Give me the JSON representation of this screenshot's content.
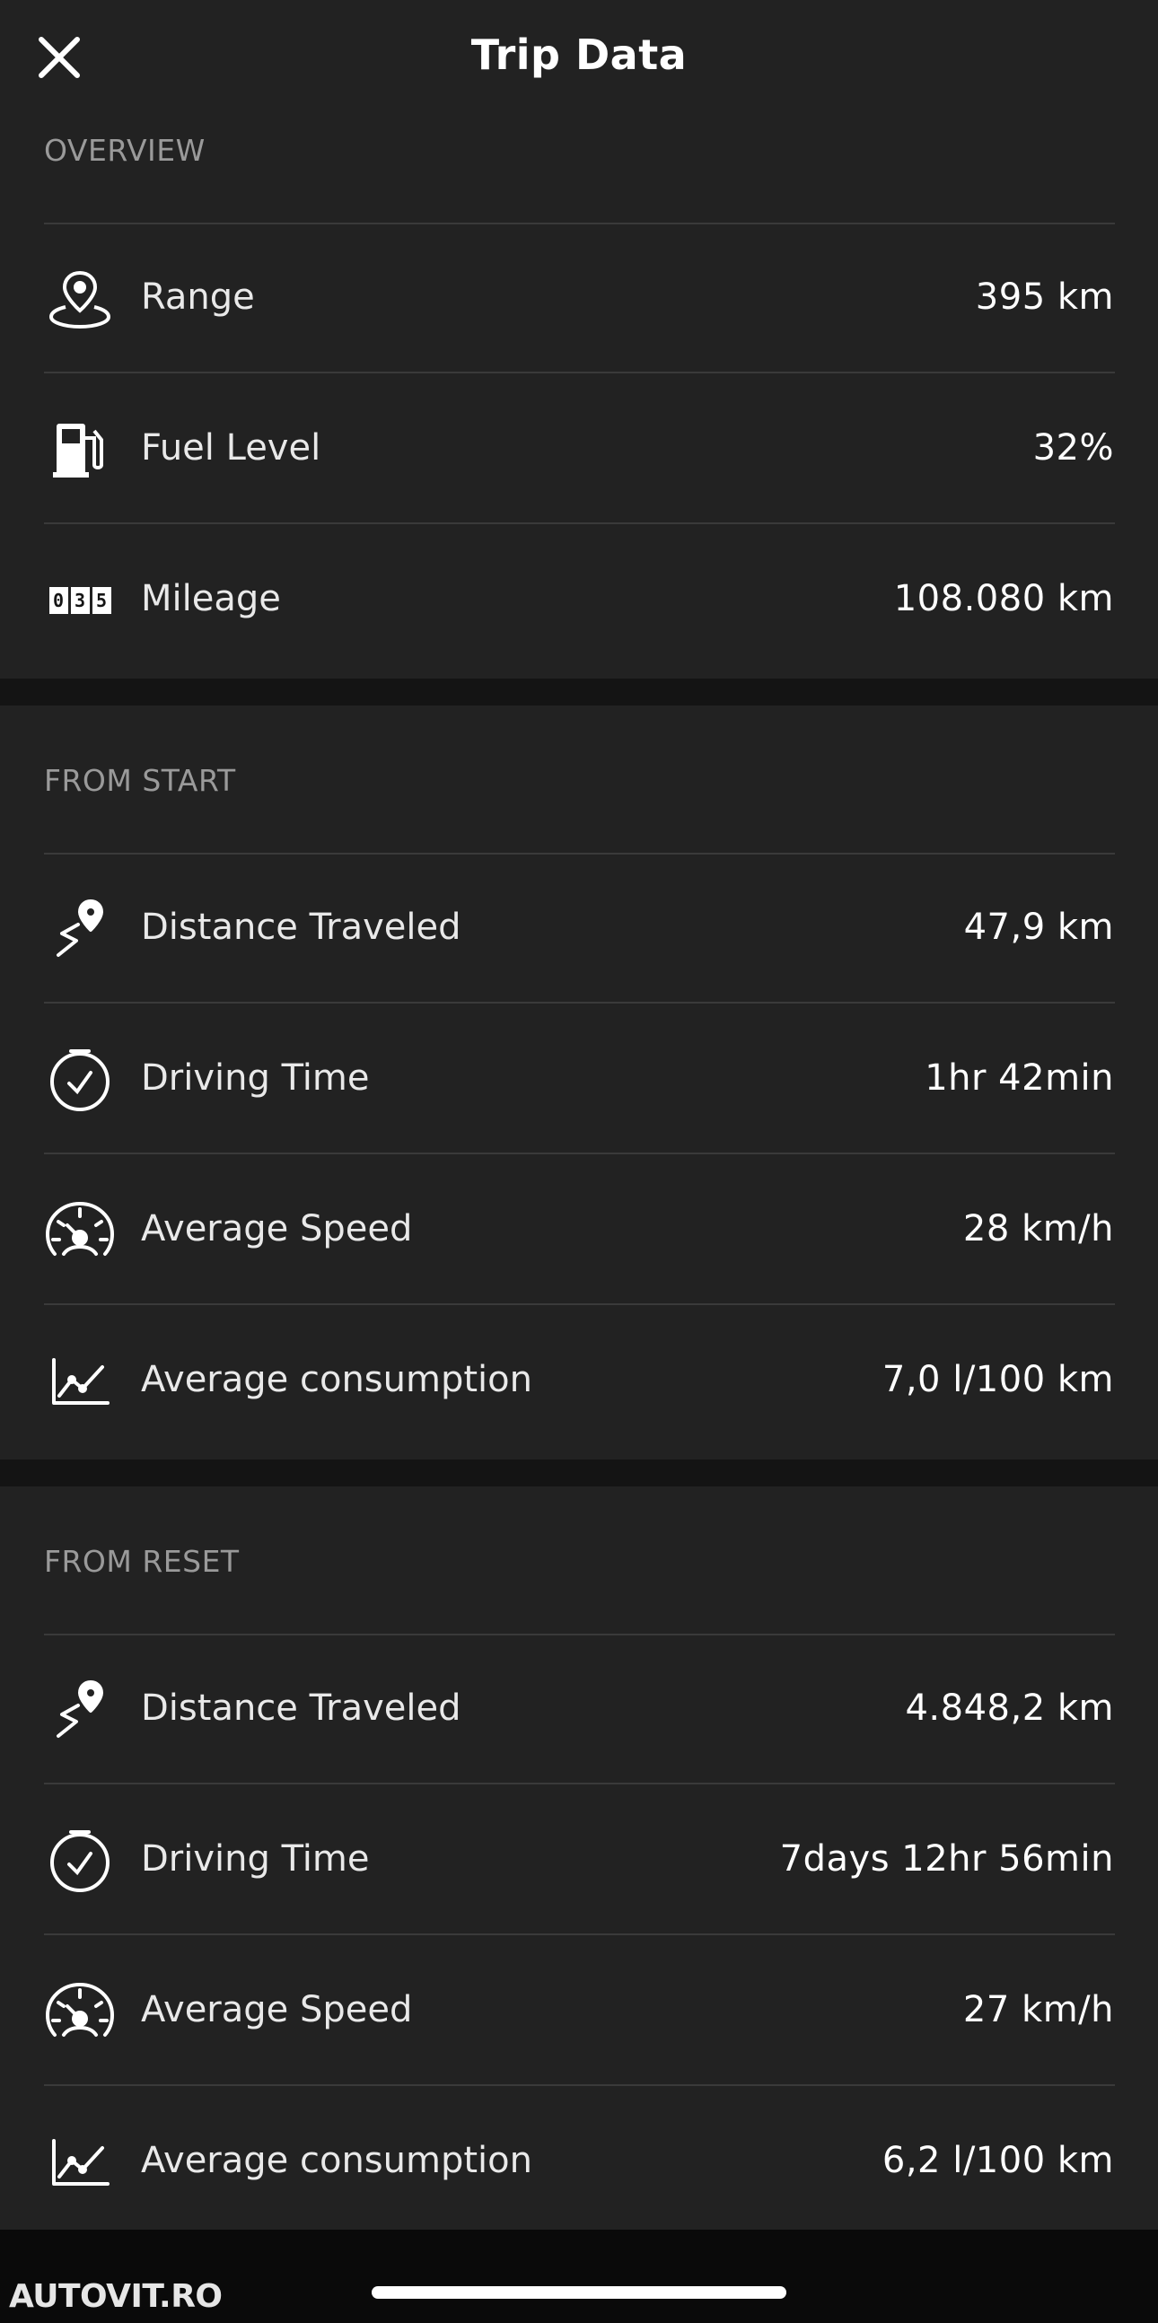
{
  "header": {
    "title": "Trip Data",
    "close_icon": "close-icon"
  },
  "sections": {
    "overview": {
      "label": "OVERVIEW",
      "rows": [
        {
          "icon": "location-pin-icon",
          "label": "Range",
          "value": "395 km"
        },
        {
          "icon": "fuel-pump-icon",
          "label": "Fuel Level",
          "value": "32%"
        },
        {
          "icon": "odometer-icon",
          "label": "Mileage",
          "value": "108.080 km",
          "odometer_digits": [
            "0",
            "3",
            "5"
          ]
        }
      ]
    },
    "from_start": {
      "label": "FROM START",
      "rows": [
        {
          "icon": "route-distance-icon",
          "label": "Distance Traveled",
          "value": "47,9 km"
        },
        {
          "icon": "clock-icon",
          "label": "Driving Time",
          "value": "1hr 42min"
        },
        {
          "icon": "speedometer-icon",
          "label": "Average Speed",
          "value": "28 km/h"
        },
        {
          "icon": "consumption-chart-icon",
          "label": "Average consumption",
          "value": "7,0 l/100 km"
        }
      ]
    },
    "from_reset": {
      "label": "FROM RESET",
      "rows": [
        {
          "icon": "route-distance-icon",
          "label": "Distance Traveled",
          "value": "4.848,2 km"
        },
        {
          "icon": "clock-icon",
          "label": "Driving Time",
          "value": "7days 12hr 56min"
        },
        {
          "icon": "speedometer-icon",
          "label": "Average Speed",
          "value": "27 km/h"
        },
        {
          "icon": "consumption-chart-icon",
          "label": "Average consumption",
          "value": "6,2 l/100 km"
        }
      ]
    }
  },
  "watermark": "AUTOVIT.RO",
  "colors": {
    "background": "#141414",
    "card": "#222222",
    "divider": "#3a3a3a",
    "section_label": "#9a9a9a"
  }
}
